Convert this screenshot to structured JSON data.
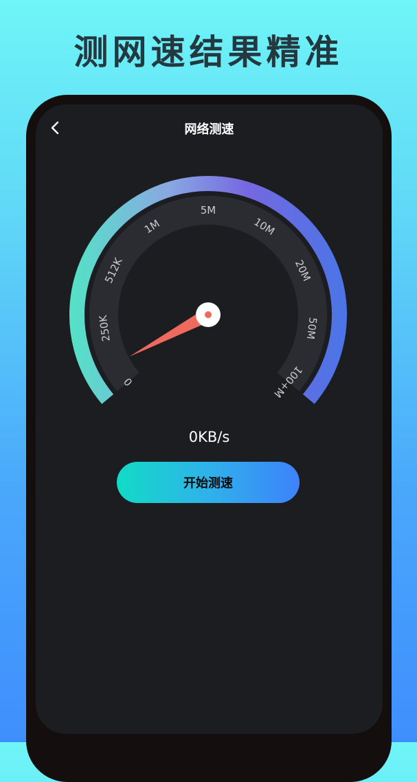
{
  "promo": {
    "title": "测网速结果精准"
  },
  "header": {
    "title": "网络测速"
  },
  "gauge": {
    "ticks": [
      "0",
      "250K",
      "512K",
      "1M",
      "5M",
      "10M",
      "20M",
      "50M",
      "100+M"
    ],
    "needle_value": "0",
    "arc_colors": [
      "#57dfc8",
      "#8aa7e3",
      "#7568e0",
      "#4d74e6"
    ],
    "needle_color": "#ef6a5e"
  },
  "speed": {
    "value": "0KB/s"
  },
  "actions": {
    "start_label": "开始测速"
  }
}
